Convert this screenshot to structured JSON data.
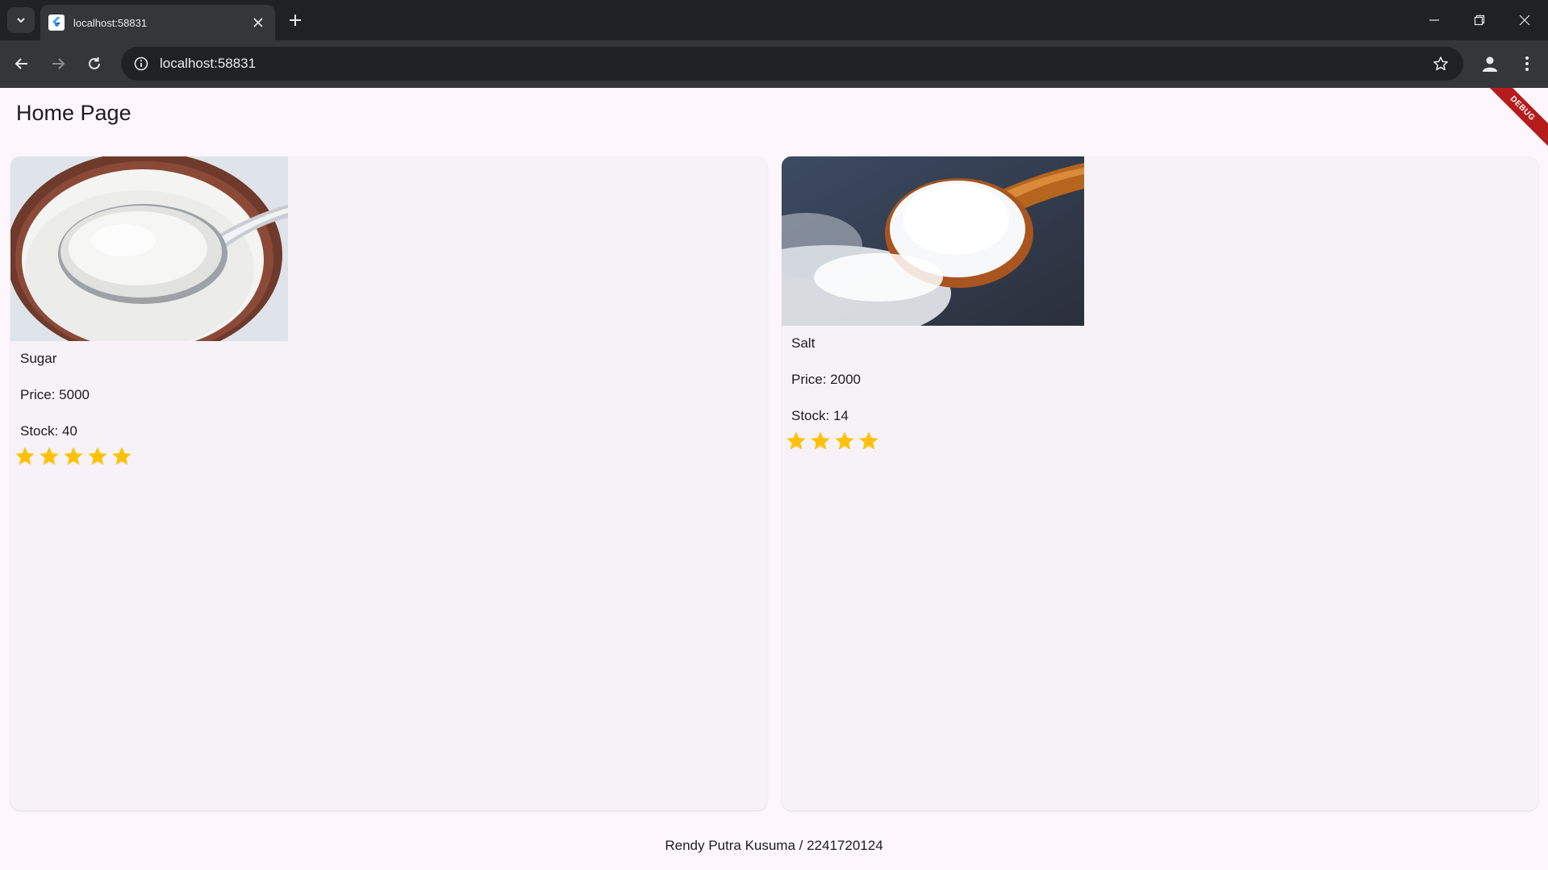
{
  "browser": {
    "tab_title": "localhost:58831",
    "url": "localhost:58831"
  },
  "app": {
    "title": "Home Page",
    "debug_banner": "DEBUG",
    "footer": "Rendy Putra Kusuma / 2241720124"
  },
  "products": [
    {
      "name": "Sugar",
      "price": "Price: 5000",
      "stock": "Stock: 40",
      "rating": 5
    },
    {
      "name": "Salt",
      "price": "Price: 2000",
      "stock": "Stock: 14",
      "rating": 4
    }
  ],
  "colors": {
    "star": "#ffc107",
    "page_bg": "#fdf7fd",
    "card_bg": "#f7f2f8",
    "chrome_dark": "#202124",
    "chrome_toolbar": "#35363a"
  },
  "icons": {
    "tab_search": "chevron-down-icon",
    "favicon": "flutter-icon",
    "close": "close-icon",
    "new_tab": "plus-icon",
    "back": "arrow-left-icon",
    "forward": "arrow-right-icon",
    "reload": "reload-icon",
    "info": "info-icon",
    "bookmark": "star-outline-icon",
    "profile": "person-icon",
    "menu": "kebab-menu-icon",
    "rating": "star-icon"
  }
}
